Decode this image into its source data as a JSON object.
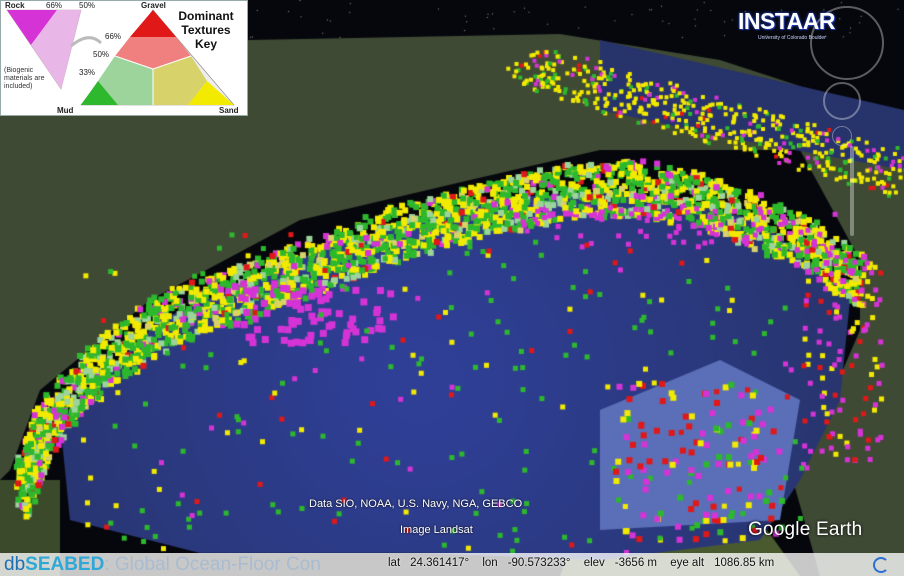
{
  "legend": {
    "title": "Dominant Textures Key",
    "rock_label": "Rock",
    "gravel_label": "Gravel",
    "mud_label": "Mud",
    "sand_label": "Sand",
    "pct_66_top": "66%",
    "pct_50_top": "50%",
    "pct_66_mid": "66%",
    "pct_50_mid": "50%",
    "pct_33": "33%",
    "biogenic_note": "(Biogenic materials are included)",
    "colors": {
      "rock": "#d633d6",
      "gravel": "#e01818",
      "mud": "#2db82d",
      "sand": "#f2ea00",
      "gravel_mix": "#f08080",
      "mud_mix": "#9cd49c",
      "sand_mix": "#d7d26a"
    }
  },
  "logo": {
    "text": "INSTAAR",
    "subtitle": "University of Colorado Boulder"
  },
  "attribution": {
    "data": "Data SIO, NOAA, U.S. Navy, NGA, GEBCO",
    "image": "Image Landsat",
    "brand": "Google Earth"
  },
  "footer": {
    "brand_db": "db",
    "brand_seabed": "SEABED",
    "brand_rest": ": Global Ocean-Floor Con",
    "lat_label": "lat",
    "lat_value": "24.361417°",
    "lon_label": "lon",
    "lon_value": "-90.573233°",
    "elev_label": "elev",
    "elev_value": "-3656 m",
    "eye_label": "eye alt",
    "eye_value": "1086.85 km"
  }
}
